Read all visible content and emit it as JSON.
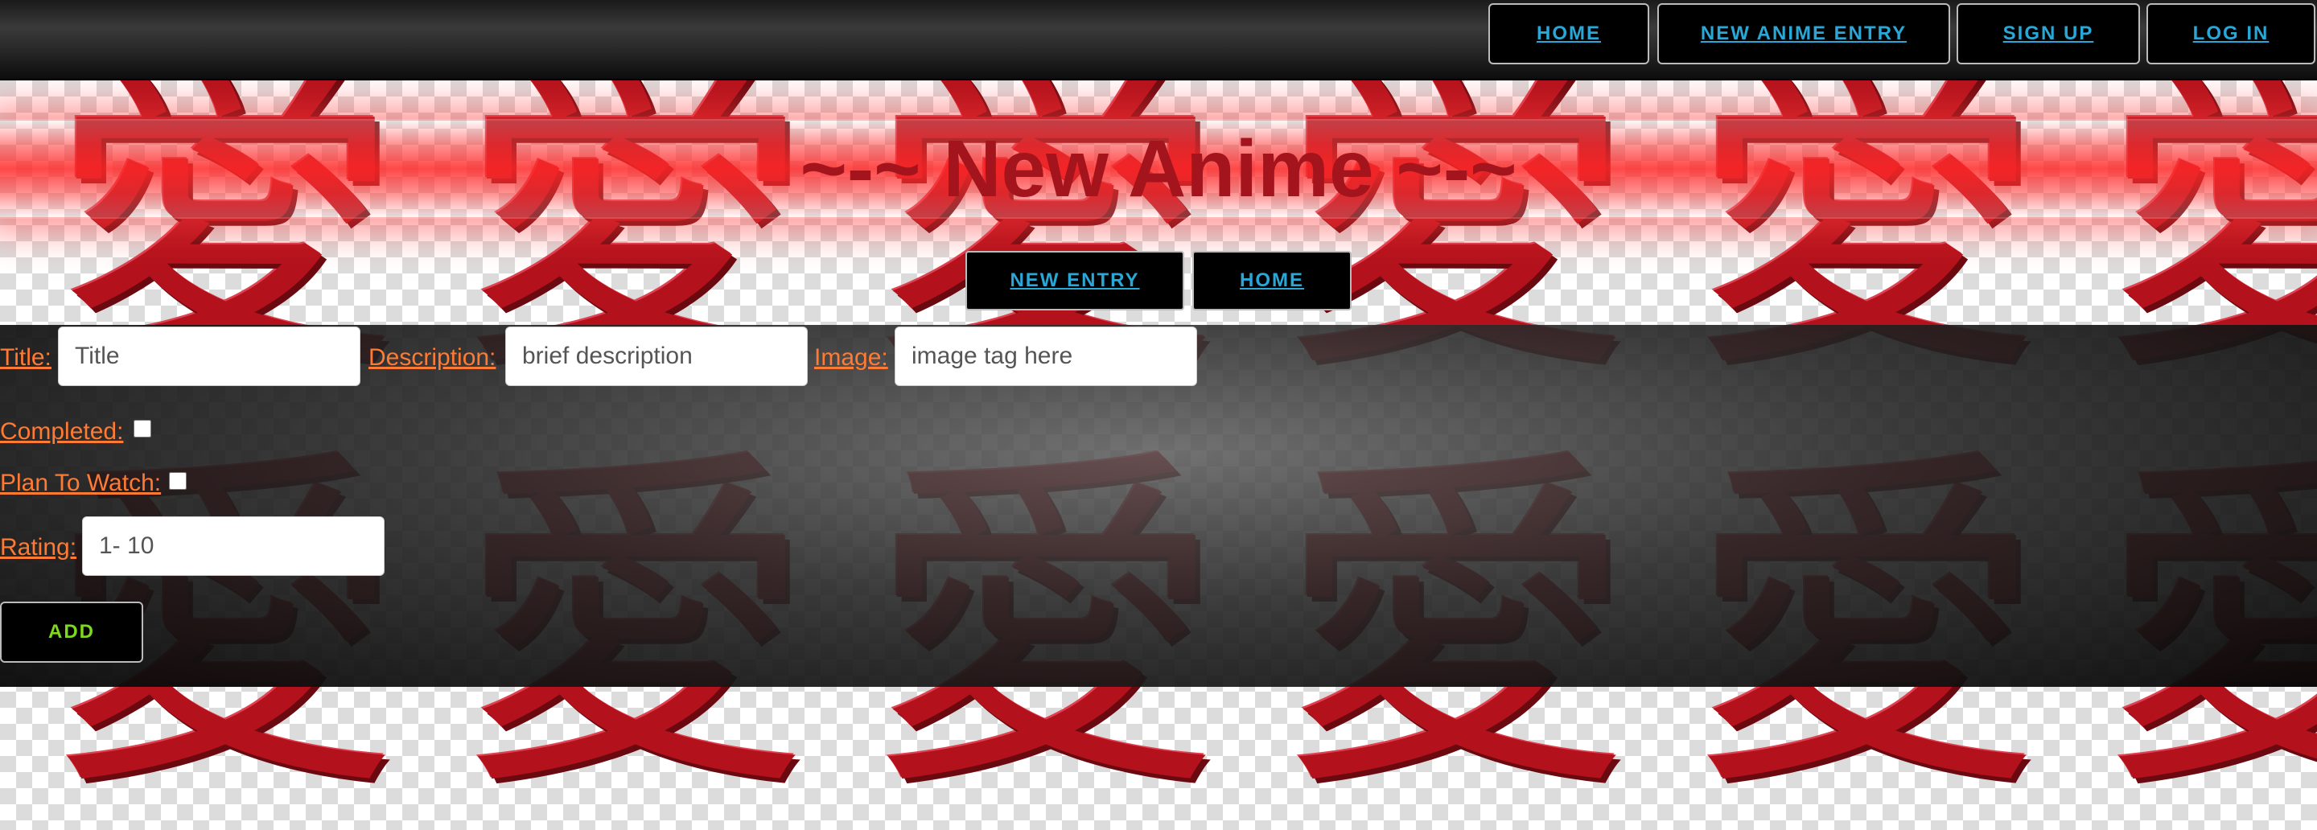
{
  "nav": {
    "items": [
      {
        "label": "HOME"
      },
      {
        "label": "NEW ANIME ENTRY"
      },
      {
        "label": "SIGN UP"
      },
      {
        "label": "LOG IN"
      }
    ]
  },
  "header": {
    "title": "~-~ New Anime ~-~"
  },
  "subnav": {
    "items": [
      {
        "label": "NEW ENTRY"
      },
      {
        "label": "HOME"
      }
    ]
  },
  "background": {
    "glyph": "愛"
  },
  "form": {
    "title_label": "Title:",
    "title_placeholder": "Title",
    "description_label": "Description:",
    "description_placeholder": "brief description",
    "image_label": "Image:",
    "image_placeholder": "image tag here",
    "completed_label": "Completed:",
    "completed_checked": false,
    "plan_label": "Plan To Watch:",
    "plan_checked": false,
    "rating_label": "Rating:",
    "rating_placeholder": "1- 10",
    "add_label": "ADD"
  },
  "colors": {
    "link": "#29a8d8",
    "label": "#ff7a33",
    "title": "#a3141c",
    "add": "#7dd81e",
    "kanji": "#b3121c"
  }
}
